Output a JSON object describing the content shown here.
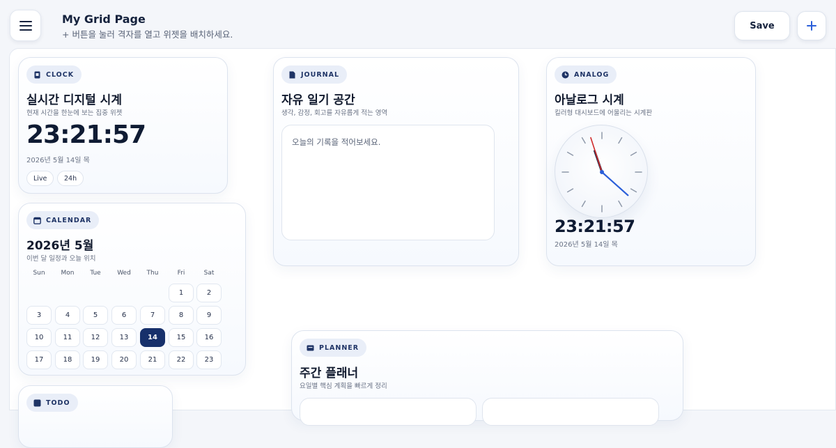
{
  "header": {
    "title": "My Grid Page",
    "subtitle": "+ 버튼을 눌러 격자를 열고 위젯을 배치하세요.",
    "save_label": "Save",
    "add_icon": "plus-icon",
    "menu_icon": "hamburger-menu-icon"
  },
  "clock": {
    "tag": "CLOCK",
    "title": "실시간 디지털 시계",
    "desc": "현재 시간을 한눈에 보는 집중 위젯",
    "time": "23:21:57",
    "date": "2026년 5월 14일 목",
    "chips": [
      "Live",
      "24h"
    ]
  },
  "journal": {
    "tag": "JOURNAL",
    "title": "자유 일기 공간",
    "desc": "생각, 감정, 회고를 자유롭게 적는 영역",
    "placeholder": "오늘의 기록을 적어보세요."
  },
  "analog": {
    "tag": "ANALOG",
    "title": "아날로그 시계",
    "desc": "킬러형 대시보드에 어울리는 시계판",
    "time": "23:21:57",
    "date": "2026년 5월 14일 목",
    "hour": 23,
    "minute": 21,
    "second": 57
  },
  "calendar": {
    "tag": "CALENDAR",
    "title": "2026년 5월",
    "desc": "이번 달 일정과 오늘 위치",
    "weekdays": [
      "Sun",
      "Mon",
      "Tue",
      "Wed",
      "Thu",
      "Fri",
      "Sat"
    ],
    "first_weekday": 5,
    "visible_days": 23,
    "today": 14
  },
  "planner": {
    "tag": "PLANNER",
    "title": "주간 플래너",
    "desc": "요일별 핵심 계획을 빠르게 정리"
  },
  "todo": {
    "tag": "TODO"
  },
  "colors": {
    "accent": "#17306b",
    "second_hand": "#d02a2a",
    "minute_hand": "#2b5fd9"
  }
}
